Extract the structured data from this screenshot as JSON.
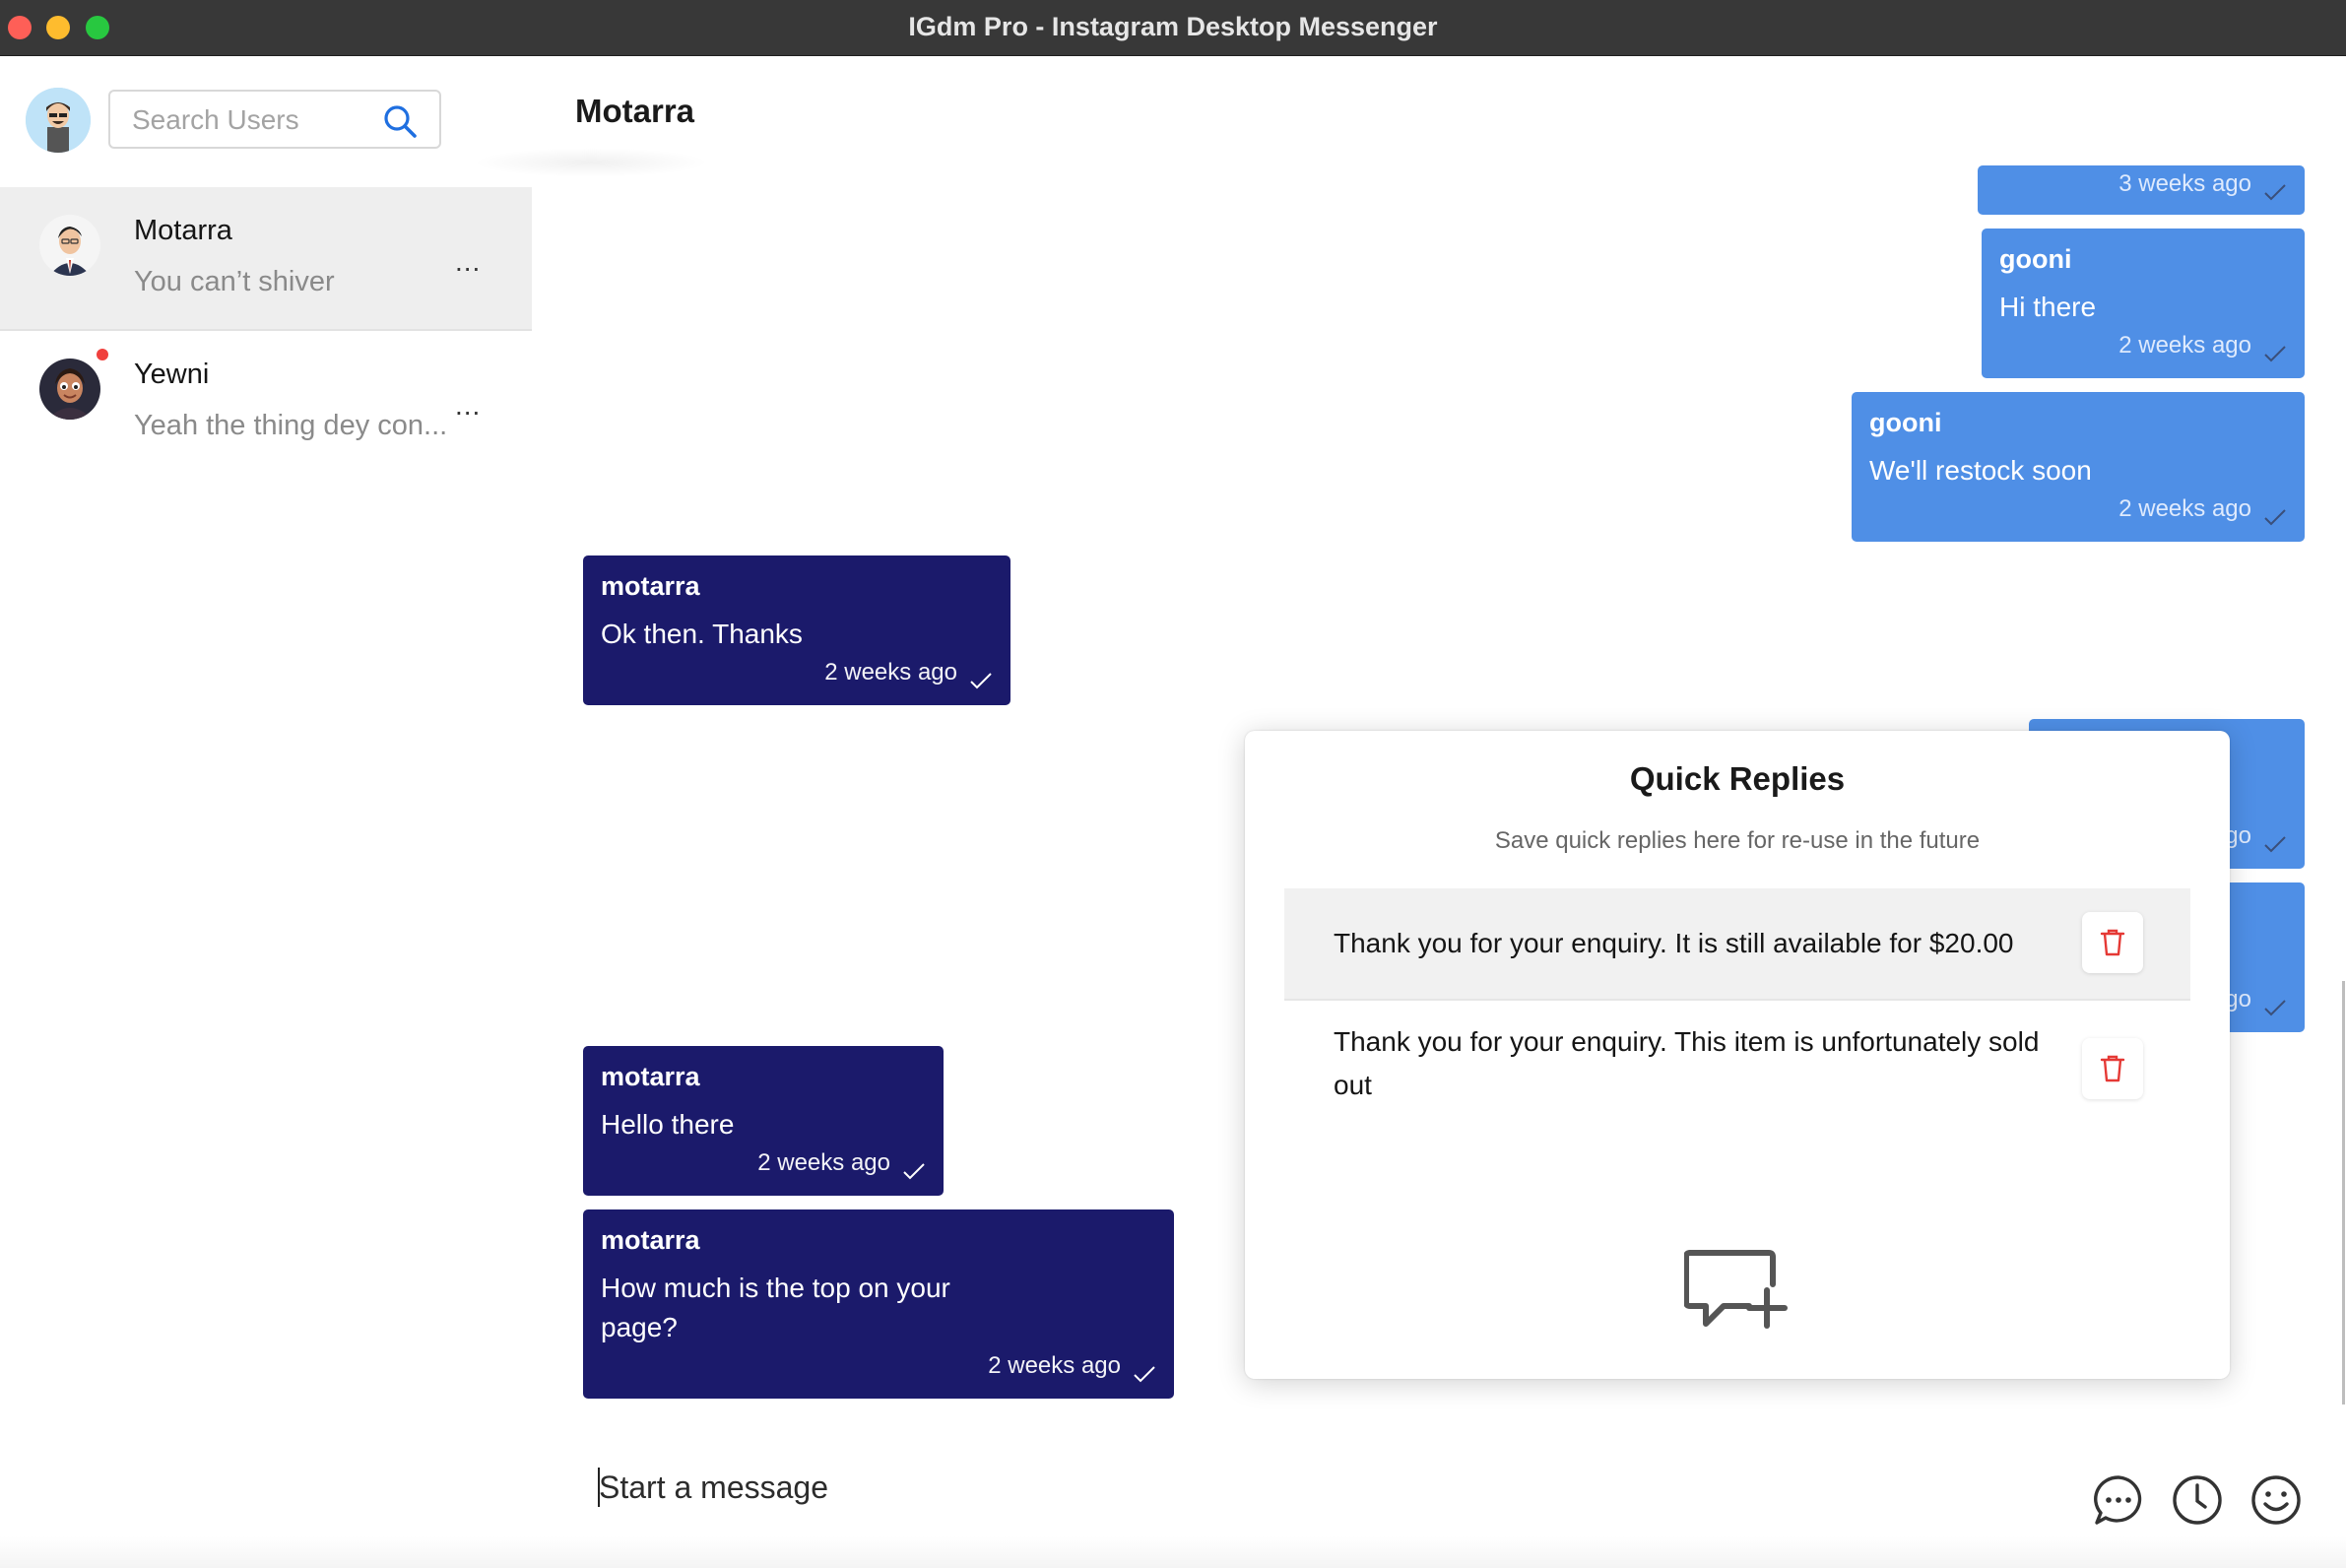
{
  "window": {
    "title": "IGdm Pro - Instagram Desktop Messenger"
  },
  "sidebar": {
    "search": {
      "placeholder": "Search Users",
      "value": ""
    },
    "conversations": [
      {
        "name": "Motarra",
        "preview": "You can’t shiver",
        "more": "...",
        "active": true,
        "unread": false
      },
      {
        "name": "Yewni",
        "preview": "Yeah the thing dey con...",
        "more": "...",
        "active": false,
        "unread": true
      }
    ]
  },
  "chat": {
    "title": "Motarra",
    "messages": [
      {
        "direction": "out",
        "sender": "",
        "text": "",
        "time": "3 weeks ago"
      },
      {
        "direction": "out",
        "sender": "gooni",
        "text": "Hi there",
        "time": "2 weeks ago"
      },
      {
        "direction": "out",
        "sender": "gooni",
        "text": "We'll restock soon",
        "time": "2 weeks ago"
      },
      {
        "direction": "in",
        "sender": "motarra",
        "text": "Ok then. Thanks",
        "time": "2 weeks ago"
      },
      {
        "direction": "out",
        "sender": "",
        "text": "",
        "time": "go"
      },
      {
        "direction": "out",
        "sender": "",
        "text": "",
        "time": "go"
      },
      {
        "direction": "in",
        "sender": "motarra",
        "text": "Hello there",
        "time": "2 weeks ago"
      },
      {
        "direction": "in",
        "sender": "motarra",
        "text": "How much is the top on your page?",
        "time": "2 weeks ago"
      }
    ]
  },
  "quick_replies": {
    "title": "Quick Replies",
    "subtitle": "Save quick replies here for re-use in the future",
    "items": [
      {
        "text": "Thank you for your enquiry. It is still available for $20.00"
      },
      {
        "text": "Thank you for your enquiry. This item is unfortunately sold out"
      }
    ]
  },
  "composer": {
    "placeholder": "Start a message",
    "value": ""
  },
  "colors": {
    "outgoing_bubble": "#4f8fe6",
    "incoming_bubble": "#1b1a6b",
    "delete_icon": "#e53935",
    "title_bar": "#383838"
  },
  "icons": {
    "composer": [
      "chat-bubble-dots-icon",
      "clock-icon",
      "smiley-icon"
    ],
    "quick_reply_add": "add-comment-icon",
    "search": "search-icon",
    "delete": "trash-icon"
  }
}
